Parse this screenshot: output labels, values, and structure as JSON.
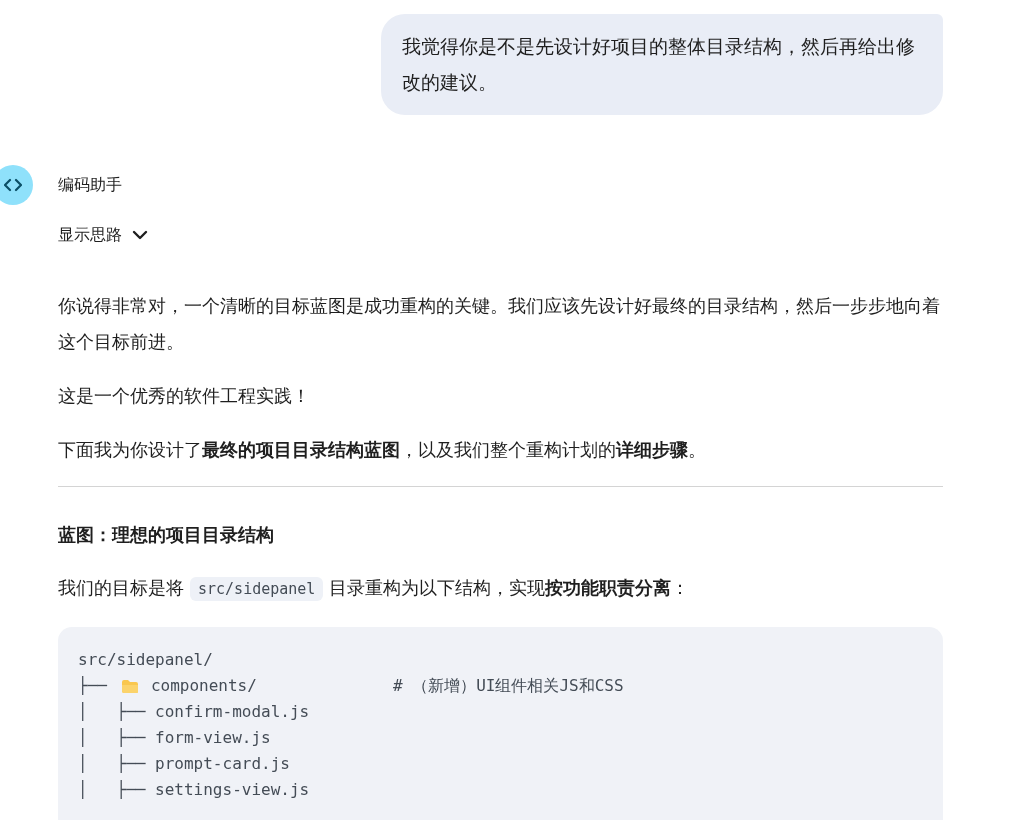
{
  "user_message": {
    "text": "我觉得你是不是先设计好项目的整体目录结构，然后再给出修改的建议。"
  },
  "assistant": {
    "name": "编码助手",
    "thoughts_toggle": {
      "label": "显示思路",
      "expanded": false
    }
  },
  "paragraphs": [
    {
      "text": "你说得非常对，一个清晰的目标蓝图是成功重构的关键。我们应该先设计好最终的目录结构，然后一步步地向着这个目标前进。"
    },
    {
      "text": "这是一个优秀的软件工程实践！"
    },
    {
      "text": "下面我为你设计了**最终的项目目录结构蓝图**，以及我们整个重构计划的**详细步骤**。"
    }
  ],
  "section_heading": "蓝图：理想的项目目录结构",
  "intro_parts": [
    {
      "kind": "text",
      "text": "我们的目标是将"
    },
    {
      "kind": "code",
      "text": "src/sidepanel"
    },
    {
      "kind": "text",
      "text": "目录重构为以下结构，实现**按功能职责分离**："
    }
  ],
  "code_lines": [
    {
      "kind": "plain",
      "text": "src/sidepanel/"
    },
    {
      "kind": "folder",
      "branch": "├──",
      "text": "components/",
      "comment": "# （新增）UI组件相关JS和CSS"
    },
    {
      "kind": "plain",
      "text": "│   ├── confirm-modal.js"
    },
    {
      "kind": "plain",
      "text": "│   ├── form-view.js"
    },
    {
      "kind": "plain",
      "text": "│   ├── prompt-card.js"
    },
    {
      "kind": "plain",
      "text": "│   ├── settings-view.js"
    }
  ]
}
